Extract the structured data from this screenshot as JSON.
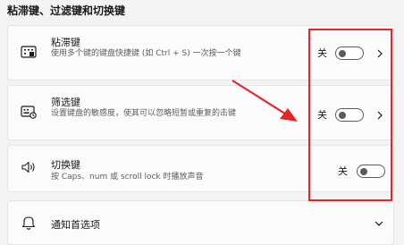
{
  "section": {
    "title": "粘滞键、过滤键和切换键"
  },
  "sticky_keys": {
    "title": "粘滞键",
    "description": "使用多个键的键盘快捷键 (如 Ctrl + S) 一次按一个键",
    "state": "关"
  },
  "filter_keys": {
    "title": "筛选键",
    "description": "设置键盘的敏感度，使其可以忽略短暂或重复的击键",
    "state": "关"
  },
  "toggle_keys": {
    "title": "切换键",
    "description": "按 Caps、num 或 scroll lock 时播放声音",
    "state": "关"
  },
  "notifications": {
    "title": "通知首选项"
  },
  "colors": {
    "annotation": "#e8242a",
    "toggle_off": "#5a5a5a"
  }
}
